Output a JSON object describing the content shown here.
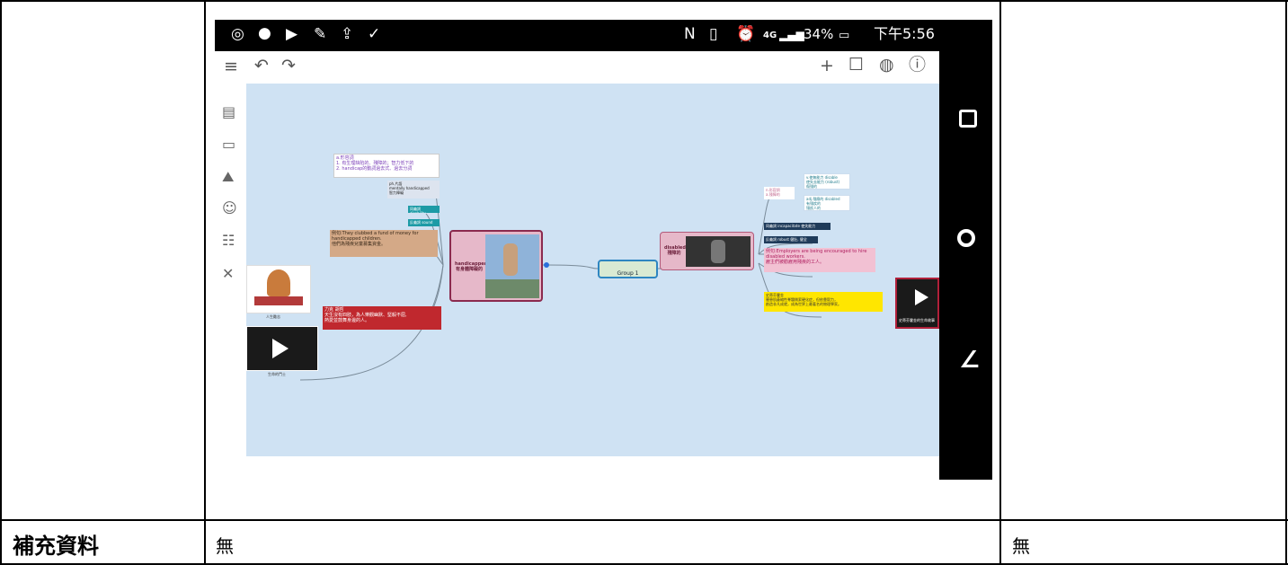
{
  "table": {
    "label_cell": "補充資料",
    "value_cell_1": "無",
    "value_cell_2": "無"
  },
  "phone": {
    "status_bar": {
      "network": "4G",
      "battery": "34%",
      "time": "下午5:56"
    },
    "mindmap": {
      "center_node": "Group 1",
      "left_main": "handicapped\n有身體障礙的",
      "right_main": "disabled\n殘障的",
      "left_def_title": "a.形容詞",
      "left_def_line1": "1. 有生理缺陷的、殘障的；智力低下的",
      "left_def_line2": "2. handicap的動詞過去式、過去分詞",
      "left_ph_title": "ph.片語",
      "left_ph_line1": "mentally handicapped",
      "left_ph_line2": "智力障礙",
      "left_syn": "同義詞 disability",
      "left_ant": "反義詞 sound",
      "left_example_en": "例句:They clubbed a fund of money for handicapped children.",
      "left_example_zh": "他們為殘疾兒童募集資金。",
      "left_red_title": "力克 胡哲",
      "left_red_line1": "天生沒有四肢，為人樂觀幽默、堅毅不屈,",
      "left_red_line2": "熱愛並鼓舞身邊的人。",
      "left_book_caption": "人生勵志",
      "left_video_caption": "生命的鬥士",
      "right_small_title1": "n.形容詞",
      "right_small_title2": "a.殘障的",
      "right_cyan_1a": "v.使無能力 disable",
      "right_cyan_1b": "使失去能力 (robust)",
      "right_cyan_1c": "傷殘的",
      "right_cyan_2a": "adj.殘廢的 disabled",
      "right_cyan_2b": "有殘疾的",
      "right_cyan_2c": "殘疾人的",
      "right_syn": "同義詞 incapacitate 使失能力",
      "right_ant": "反義詞 robust 健壯, 健全",
      "right_example_en": "例句:Employers are being encouraged to hire disabled workers.",
      "right_example_zh": "雇主們被勸雇用殘疾的工人。",
      "right_yellow_title": "史蒂芬霍金",
      "right_yellow_line1": "罹患肌萎縮性脊髓側索硬化症，但依靠毅力，",
      "right_yellow_line2": "創造非凡成就，成為世界上最著名的物理學家。",
      "right_video_caption": "史蒂芬霍金的生命故事"
    }
  },
  "colors": {
    "canvas": "#cfe2f3",
    "main_node": "#e6b8c9",
    "center_node": "#d9ead3",
    "red_note": "#c0282e",
    "yellow_note": "#ffe600"
  }
}
